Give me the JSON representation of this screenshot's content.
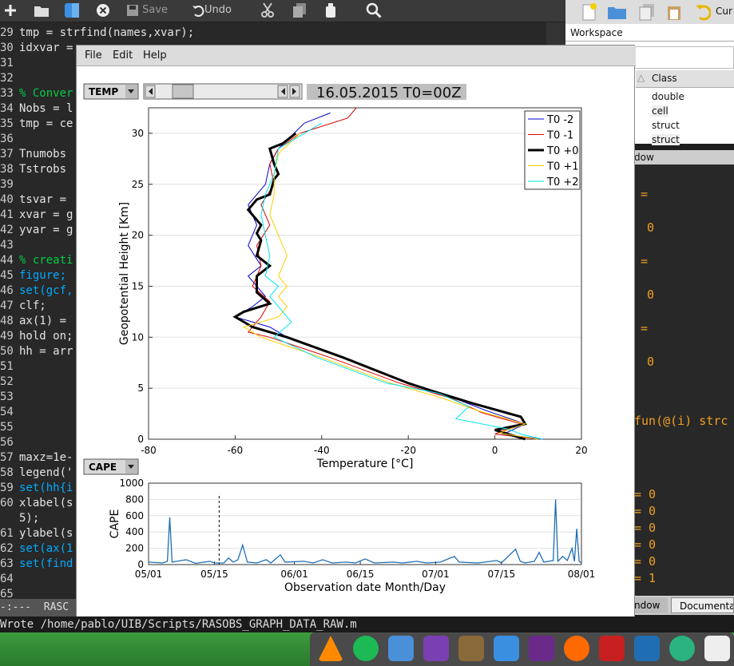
{
  "editor": {
    "toolbar": {
      "save_label": "Save",
      "undo_label": "Undo"
    },
    "lines": [
      {
        "num": "29",
        "text": "tmp = strfind(names,xvar);"
      },
      {
        "num": "30",
        "text": "idxvar = "
      },
      {
        "num": "31",
        "text": ""
      },
      {
        "num": "32",
        "text": ""
      },
      {
        "num": "33",
        "text": "% Conver"
      },
      {
        "num": "34",
        "text": "Nobs = l"
      },
      {
        "num": "35",
        "text": "tmp = ce"
      },
      {
        "num": "36",
        "text": ""
      },
      {
        "num": "37",
        "text": "Tnumobs "
      },
      {
        "num": "38",
        "text": "Tstrobs "
      },
      {
        "num": "39",
        "text": ""
      },
      {
        "num": "40",
        "text": "tsvar = "
      },
      {
        "num": "41",
        "text": "xvar = g"
      },
      {
        "num": "42",
        "text": "yvar = g"
      },
      {
        "num": "43",
        "text": ""
      },
      {
        "num": "44",
        "text": "% creati"
      },
      {
        "num": "45",
        "text": "figure;"
      },
      {
        "num": "46",
        "text": "set(gcf,"
      },
      {
        "num": "47",
        "text": "clf;"
      },
      {
        "num": "48",
        "text": "ax(1) = "
      },
      {
        "num": "49",
        "text": "hold on;"
      },
      {
        "num": "50",
        "text": "hh = arr"
      },
      {
        "num": "51",
        "text": ""
      },
      {
        "num": "52",
        "text": ""
      },
      {
        "num": "53",
        "text": ""
      },
      {
        "num": "54",
        "text": ""
      },
      {
        "num": "55",
        "text": ""
      },
      {
        "num": "56",
        "text": ""
      },
      {
        "num": "57",
        "text": "maxz=1e-"
      },
      {
        "num": "58",
        "text": "legend('"
      },
      {
        "num": "59",
        "text": "set(hh{i"
      },
      {
        "num": "60",
        "text": "xlabel(s"
      },
      {
        "num": "",
        "text": "5);"
      },
      {
        "num": "61",
        "text": "ylabel(s"
      },
      {
        "num": "62",
        "text": "set(ax(1"
      },
      {
        "num": "63",
        "text": "set(find"
      },
      {
        "num": "64",
        "text": ""
      },
      {
        "num": "65",
        "text": ""
      }
    ],
    "modeline": "-:---  RASC",
    "minibuffer": "Wrote /home/pablo/UIB/Scripts/RASOBS_GRAPH_DATA_RAW.m"
  },
  "workspace": {
    "toolbar_label": "Cur",
    "title": "Workspace",
    "column_header": "Class",
    "rows": [
      "double",
      "cell",
      "struct",
      "struct"
    ]
  },
  "command_window": {
    "title": "dow",
    "values": [
      "=",
      "0",
      "=",
      "0",
      "=",
      "0",
      "fun(@(i) strc",
      "= 0",
      "= 0",
      "= 0",
      "= 0",
      "= 0",
      "= 1"
    ],
    "tab_window": "ndow",
    "tab_doc": "Documentat"
  },
  "figure": {
    "menu": [
      "File",
      "Edit",
      "Help"
    ],
    "top_popup": "TEMP",
    "date_label": "16.05.2015 T0=00Z",
    "bottom_popup": "CAPE"
  },
  "chart_data": [
    {
      "type": "line",
      "title": "",
      "xlabel": "Temperature [°C]",
      "ylabel": "Geopotential Height [Km]",
      "xlim": [
        -80,
        20
      ],
      "ylim": [
        0,
        32.5
      ],
      "xticks": [
        -80,
        -60,
        -40,
        -20,
        0,
        20
      ],
      "yticks": [
        0,
        5,
        10,
        15,
        20,
        25,
        30
      ],
      "grid": "horizontal",
      "legend_position": "top-right",
      "series": [
        {
          "name": "T0 -2",
          "color": "#0000cc",
          "width": 1,
          "points": [
            [
              11,
              0
            ],
            [
              2,
              0.5
            ],
            [
              7,
              1.5
            ],
            [
              -2,
              2.8
            ],
            [
              -8,
              3.8
            ],
            [
              -20,
              5.5
            ],
            [
              -35,
              8
            ],
            [
              -48,
              10
            ],
            [
              -52,
              11
            ],
            [
              -60,
              12
            ],
            [
              -56,
              13
            ],
            [
              -53,
              14
            ],
            [
              -57,
              16
            ],
            [
              -54,
              17
            ],
            [
              -57,
              19
            ],
            [
              -55,
              21
            ],
            [
              -57,
              23
            ],
            [
              -53,
              25
            ],
            [
              -52,
              27
            ],
            [
              -50,
              28.5
            ],
            [
              -44,
              31
            ],
            [
              -38,
              32
            ]
          ]
        },
        {
          "name": "T0 -1",
          "color": "#dd0000",
          "width": 1,
          "points": [
            [
              10,
              0
            ],
            [
              0,
              0.5
            ],
            [
              6,
              1.5
            ],
            [
              -3,
              2.6
            ],
            [
              -10,
              4
            ],
            [
              -22,
              5.5
            ],
            [
              -38,
              8
            ],
            [
              -52,
              10
            ],
            [
              -57,
              10.5
            ],
            [
              -54,
              12
            ],
            [
              -52,
              13.5
            ],
            [
              -56,
              15
            ],
            [
              -54,
              17
            ],
            [
              -55,
              19
            ],
            [
              -52,
              21
            ],
            [
              -54,
              23
            ],
            [
              -51,
              25
            ],
            [
              -52,
              27
            ],
            [
              -50,
              28.5
            ],
            [
              -45,
              30
            ],
            [
              -34,
              31.5
            ],
            [
              -32,
              32.5
            ]
          ]
        },
        {
          "name": "T0 +0",
          "color": "#000000",
          "width": 3,
          "points": [
            [
              7,
              0
            ],
            [
              0,
              0.9
            ],
            [
              7,
              1.5
            ],
            [
              6,
              2.2
            ],
            [
              -5,
              3.5
            ],
            [
              -15,
              4.8
            ],
            [
              -20,
              5.5
            ],
            [
              -35,
              8
            ],
            [
              -48,
              10
            ],
            [
              -56,
              11
            ],
            [
              -60,
              12
            ],
            [
              -58,
              12.5
            ],
            [
              -52,
              13.3
            ],
            [
              -55,
              14.4
            ],
            [
              -55,
              16
            ],
            [
              -52,
              17
            ],
            [
              -55,
              18
            ],
            [
              -54,
              19.5
            ],
            [
              -55,
              20.2
            ],
            [
              -54,
              21
            ],
            [
              -57,
              22.5
            ],
            [
              -55,
              23.5
            ],
            [
              -52,
              24
            ],
            [
              -51,
              25.5
            ],
            [
              -50,
              26
            ],
            [
              -51,
              27
            ],
            [
              -52,
              28.5
            ],
            [
              -49,
              29
            ],
            [
              -46,
              30
            ]
          ]
        },
        {
          "name": "T0 +1",
          "color": "#ffcc00",
          "width": 1,
          "points": [
            [
              10,
              0
            ],
            [
              1,
              0.6
            ],
            [
              7,
              1.5
            ],
            [
              -4,
              2.8
            ],
            [
              -12,
              4
            ],
            [
              -24,
              5.5
            ],
            [
              -40,
              8
            ],
            [
              -54,
              10
            ],
            [
              -58,
              11
            ],
            [
              -50,
              12
            ],
            [
              -48,
              13
            ],
            [
              -50,
              14
            ],
            [
              -48,
              15
            ],
            [
              -50,
              16
            ],
            [
              -48,
              18
            ],
            [
              -50,
              20
            ],
            [
              -52,
              22
            ],
            [
              -51,
              24
            ],
            [
              -51,
              26
            ],
            [
              -50,
              28
            ],
            [
              -45,
              30
            ]
          ]
        },
        {
          "name": "T0 +2",
          "color": "#00e5ee",
          "width": 1,
          "points": [
            [
              11,
              0
            ],
            [
              6,
              0.5
            ],
            [
              3,
              1
            ],
            [
              -9,
              2
            ],
            [
              -6,
              3.2
            ],
            [
              -13,
              4.5
            ],
            [
              -25,
              5.5
            ],
            [
              -41,
              8
            ],
            [
              -51,
              10
            ],
            [
              -47,
              11.5
            ],
            [
              -49,
              12.5
            ],
            [
              -52,
              14
            ],
            [
              -50,
              15
            ],
            [
              -53,
              16
            ],
            [
              -52,
              18
            ],
            [
              -53,
              20
            ],
            [
              -54,
              22
            ],
            [
              -53,
              24
            ],
            [
              -51,
              26
            ],
            [
              -50,
              28.5
            ],
            [
              -44,
              30
            ],
            [
              -40,
              31
            ]
          ]
        }
      ]
    },
    {
      "type": "line",
      "title": "",
      "xlabel": "Observation date Month/Day",
      "ylabel": "CAPE",
      "ylim": [
        0,
        1000
      ],
      "yticks": [
        0,
        200,
        400,
        600,
        800,
        1000
      ],
      "x_categories": [
        "05/01",
        "05/15",
        "06/01",
        "06/15",
        "07/01",
        "07/15",
        "08/01"
      ],
      "grid": "horizontal",
      "marker_day": 15,
      "series": [
        {
          "name": "",
          "color": "#1f6eb4",
          "points": [
            [
              0,
              30
            ],
            [
              3,
              20
            ],
            [
              4,
              40
            ],
            [
              4.5,
              580
            ],
            [
              5,
              30
            ],
            [
              8,
              60
            ],
            [
              10,
              15
            ],
            [
              13,
              40
            ],
            [
              14,
              20
            ],
            [
              16,
              20
            ],
            [
              17,
              80
            ],
            [
              18,
              30
            ],
            [
              19,
              60
            ],
            [
              20,
              240
            ],
            [
              21,
              30
            ],
            [
              23,
              20
            ],
            [
              25,
              60
            ],
            [
              26,
              20
            ],
            [
              28,
              120
            ],
            [
              29,
              30
            ],
            [
              33,
              40
            ],
            [
              35,
              20
            ],
            [
              37,
              60
            ],
            [
              39,
              20
            ],
            [
              42,
              30
            ],
            [
              44,
              20
            ],
            [
              46,
              70
            ],
            [
              48,
              20
            ],
            [
              52,
              30
            ],
            [
              54,
              20
            ],
            [
              57,
              40
            ],
            [
              59,
              20
            ],
            [
              62,
              30
            ],
            [
              65,
              100
            ],
            [
              66,
              30
            ],
            [
              70,
              20
            ],
            [
              74,
              50
            ],
            [
              75,
              20
            ],
            [
              78,
              190
            ],
            [
              79,
              40
            ],
            [
              80,
              20
            ],
            [
              82,
              40
            ],
            [
              83,
              150
            ],
            [
              84,
              30
            ],
            [
              86,
              50
            ],
            [
              86.5,
              800
            ],
            [
              87,
              40
            ],
            [
              88,
              100
            ],
            [
              89,
              50
            ],
            [
              90,
              200
            ],
            [
              90.5,
              40
            ],
            [
              91,
              440
            ],
            [
              91.5,
              40
            ],
            [
              92,
              20
            ]
          ]
        }
      ]
    }
  ]
}
